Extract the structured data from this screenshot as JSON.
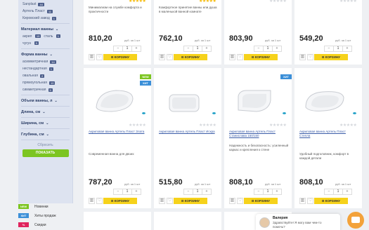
{
  "sidebar": {
    "brands": [
      {
        "name": "Sanplast",
        "count": "44"
      },
      {
        "name": "Артель Пласт",
        "count": "11"
      },
      {
        "name": "Кировский завод",
        "count": "1"
      }
    ],
    "material_heading": "Материал ванны",
    "materials": [
      "акрил",
      "сталь",
      "чугун"
    ],
    "material_counts": [
      "19",
      "1",
      "9"
    ],
    "shape_heading": "Форма ванны",
    "shapes": [
      {
        "name": "асимметричная",
        "count": "14"
      },
      {
        "name": "нестандартная",
        "count": "1"
      },
      {
        "name": "овальная",
        "count": "2"
      },
      {
        "name": "прямоугольная",
        "count": "10"
      },
      {
        "name": "симметричная",
        "count": "5"
      }
    ],
    "volume_heading": "Объем ванны, л",
    "length_heading": "Длина, см",
    "width_heading": "Ширина, см",
    "depth_heading": "Глубина, см",
    "reset_label": "Сбросить",
    "show_label": "ПОКАЗАТЬ"
  },
  "links": [
    {
      "badge": "NEW",
      "label": "Новинки",
      "color": "#7cc521"
    },
    {
      "badge": "ХИТ",
      "label": "Хиты продаж",
      "color": "#3b8fd8"
    },
    {
      "badge": "%",
      "label": "Скидки",
      "color": "#e0245e"
    }
  ],
  "common": {
    "per_unit": "руб. за 1 шт",
    "qty_minus": "−",
    "qty_value": "1",
    "qty_plus": "+",
    "cart_label": "В КОРЗИНУ",
    "compare_icon": "bar-chart-icon",
    "fav_icon": "heart-icon"
  },
  "top_row": [
    {
      "desc": "Минимализм на службе комфорта и практичности",
      "price": "810,20",
      "rated": true
    },
    {
      "desc": "Комфортное принятие ванны или душа в маленькой ванной комнате",
      "price": "762,10",
      "rated": true
    },
    {
      "desc": "",
      "price": "803,90",
      "rated": false
    },
    {
      "desc": "",
      "price": "549,20",
      "rated": false
    }
  ],
  "products": [
    {
      "name": "Акриловая ванна Артель Пласт Злата",
      "desc": "Современная ванна для двоих",
      "price": "787,20",
      "badges": [
        "NEW",
        "ХИТ"
      ]
    },
    {
      "name": "Акриловая ванна Артель Пласт Искра",
      "desc": "",
      "price": "515,80",
      "badges": []
    },
    {
      "name": "Акриловая ванна Артель Пласт Станислава 150/150",
      "desc": "Надежность и безопасность: усиленный каркас и крепления к стене",
      "price": "808,10",
      "badges": [
        "ХИТ"
      ]
    },
    {
      "name": "Акриловая ванна Артель Пласт Стелла",
      "desc": "Удобный подголовник, комфорт в каждой детали",
      "price": "808,10",
      "badges": []
    }
  ],
  "chat": {
    "name": "Валерия",
    "message": "Здравствуйте! Я могу вам чем-то помочь?"
  }
}
